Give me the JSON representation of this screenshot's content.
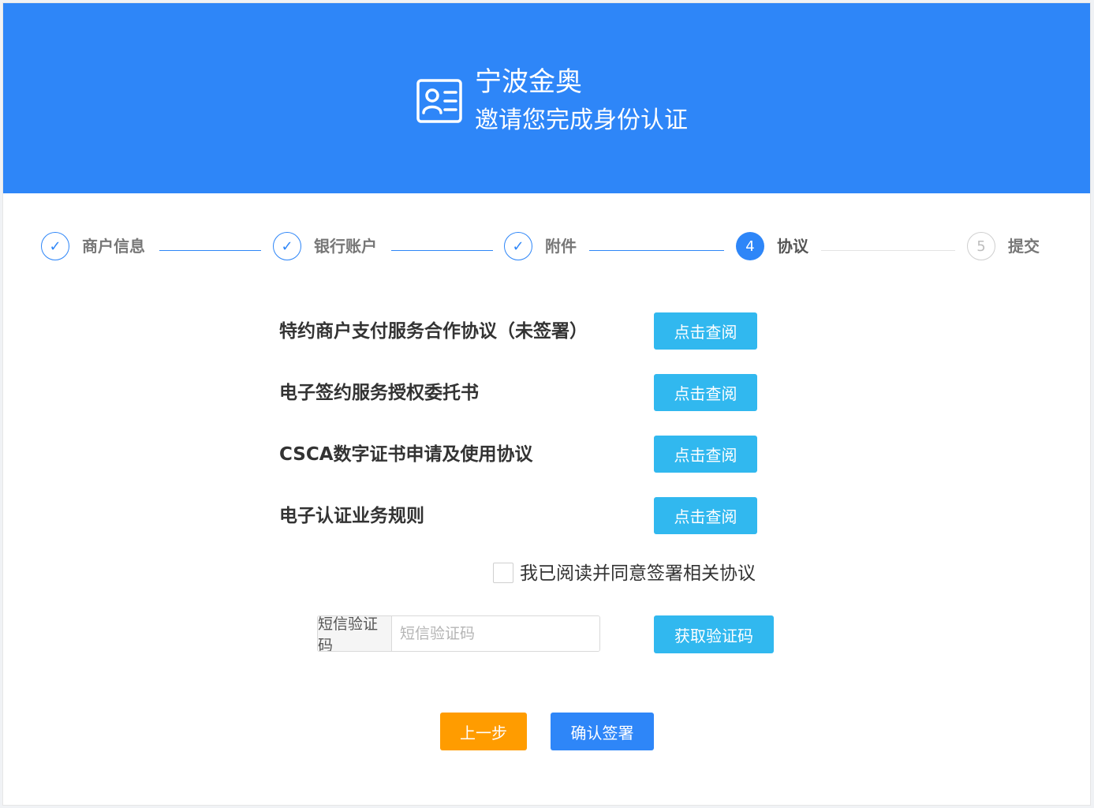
{
  "header": {
    "brand": "宁波金奥",
    "subtitle": "邀请您完成身份认证",
    "icon": "id-card-icon"
  },
  "steps": [
    {
      "number": "1",
      "label": "商户信息",
      "status": "done"
    },
    {
      "number": "2",
      "label": "银行账户",
      "status": "done"
    },
    {
      "number": "3",
      "label": "附件",
      "status": "done"
    },
    {
      "number": "4",
      "label": "协议",
      "status": "active"
    },
    {
      "number": "5",
      "label": "提交",
      "status": "pending"
    }
  ],
  "agreements": [
    {
      "title": "特约商户支付服务合作协议（未签署）",
      "button": "点击查阅"
    },
    {
      "title": "电子签约服务授权委托书",
      "button": "点击查阅"
    },
    {
      "title": "CSCA数字证书申请及使用协议",
      "button": "点击查阅"
    },
    {
      "title": "电子认证业务规则",
      "button": "点击查阅"
    }
  ],
  "agree": {
    "label": "我已阅读并同意签署相关协议",
    "checked": false
  },
  "sms": {
    "addon": "短信验证码",
    "placeholder": "短信验证码",
    "value": "",
    "get_code": "获取验证码"
  },
  "actions": {
    "prev": "上一步",
    "confirm": "确认签署"
  },
  "colors": {
    "primary": "#2e86f8",
    "view_button": "#31b8ef",
    "prev_button": "#ff9c00"
  }
}
